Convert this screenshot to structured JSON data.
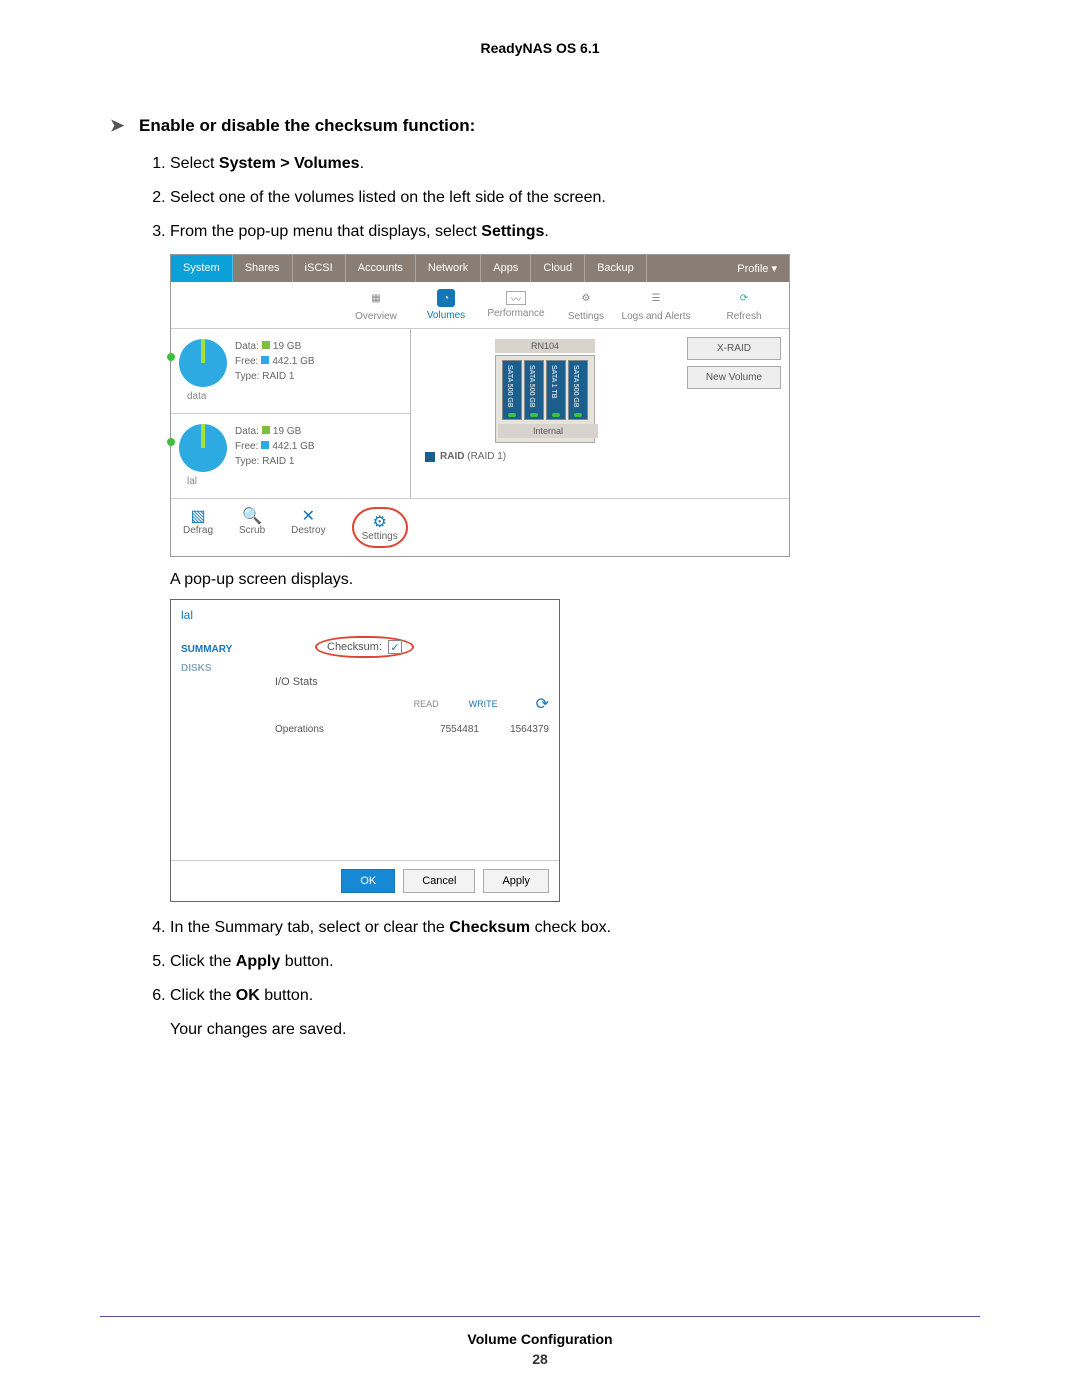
{
  "doc": {
    "header": "ReadyNAS OS 6.1",
    "section_title": "Enable or disable the checksum function:",
    "steps": {
      "s1a": "Select ",
      "s1b": "System > Volumes",
      "s1c": ".",
      "s2": "Select one of the volumes listed on the left side of the screen.",
      "s3a": "From the pop-up menu that displays, select ",
      "s3b": "Settings",
      "s3c": ".",
      "caption1": "A pop-up screen displays.",
      "s4a": "In the Summary tab, select or clear the ",
      "s4b": "Checksum",
      "s4c": " check box.",
      "s5a": "Click the ",
      "s5b": "Apply",
      "s5c": " button.",
      "s6a": "Click the ",
      "s6b": "OK",
      "s6c": " button.",
      "result": "Your changes are saved."
    },
    "footer_title": "Volume Configuration",
    "footer_page": "28"
  },
  "ss1": {
    "tabs": [
      "System",
      "Shares",
      "iSCSI",
      "Accounts",
      "Network",
      "Apps",
      "Cloud",
      "Backup"
    ],
    "profile": "Profile ▾",
    "subnav": [
      "Overview",
      "Volumes",
      "Performance",
      "Settings",
      "Logs and Alerts"
    ],
    "refresh": "Refresh",
    "vol1": {
      "name": "data",
      "data": "19 GB",
      "free": "442.1 GB",
      "type": "RAID 1"
    },
    "vol2": {
      "name": "lal",
      "data": "19 GB",
      "free": "442.1 GB",
      "type": "RAID 1"
    },
    "labels": {
      "data": "Data:",
      "free": "Free:",
      "type": "Type:"
    },
    "device": "RN104",
    "drives": [
      "SATA 500 GB",
      "SATA 500 GB",
      "SATA 1 TB",
      "SATA 500 GB"
    ],
    "internal": "Internal",
    "raid_label": "RAID",
    "raid_type": "(RAID 1)",
    "xraid": "X-RAID",
    "newvol": "New Volume",
    "toolbar": [
      "Defrag",
      "Scrub",
      "Destroy",
      "Settings"
    ]
  },
  "ss2": {
    "title": "lal",
    "side": [
      "SUMMARY",
      "DISKS"
    ],
    "checksum": "Checksum:",
    "iostats": "I/O Stats",
    "read": "READ",
    "write": "WRITE",
    "ops": "Operations",
    "ops_read": "7554481",
    "ops_write": "1564379",
    "buttons": {
      "ok": "OK",
      "cancel": "Cancel",
      "apply": "Apply"
    }
  }
}
